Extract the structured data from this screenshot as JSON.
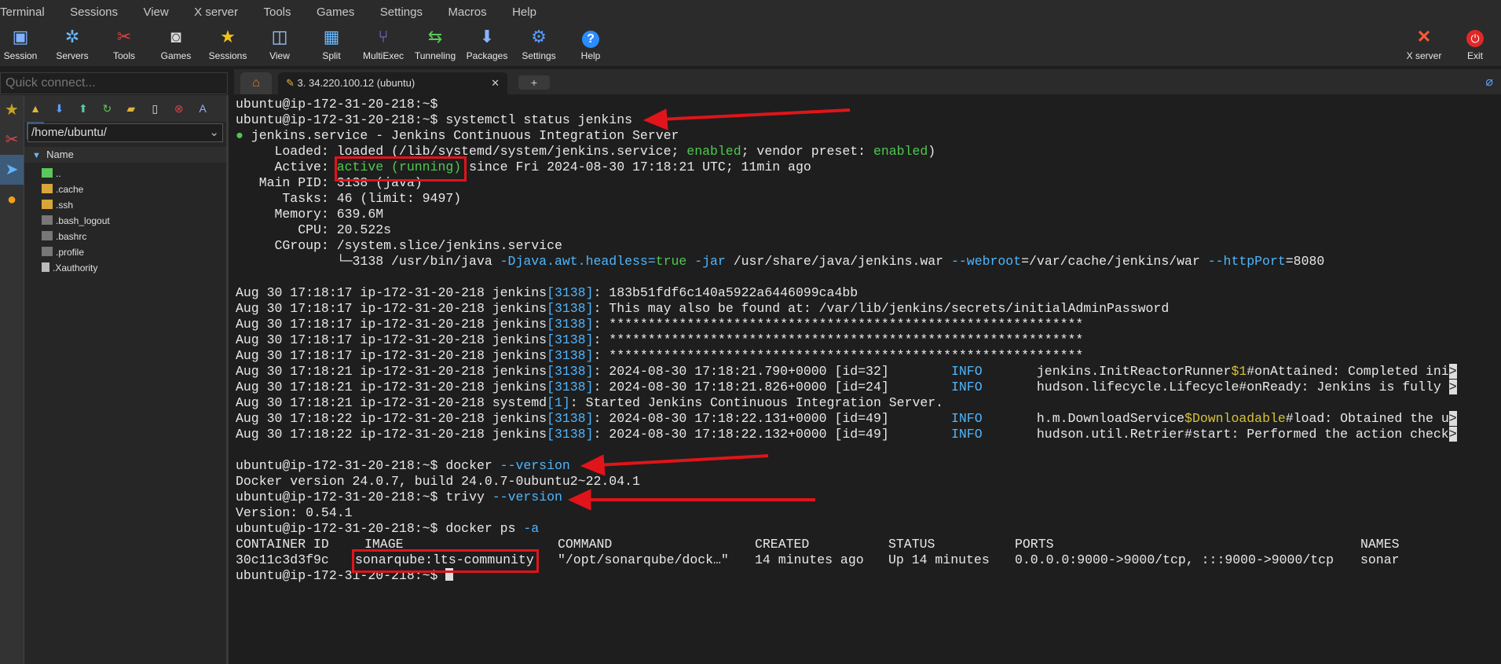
{
  "menu": [
    "Terminal",
    "Sessions",
    "View",
    "X server",
    "Tools",
    "Games",
    "Settings",
    "Macros",
    "Help"
  ],
  "toolbar": [
    {
      "label": "Session",
      "icon": "session-icon"
    },
    {
      "label": "Servers",
      "icon": "servers-icon"
    },
    {
      "label": "Tools",
      "icon": "tools-icon"
    },
    {
      "label": "Games",
      "icon": "games-icon"
    },
    {
      "label": "Sessions",
      "icon": "sessions-star-icon"
    },
    {
      "label": "View",
      "icon": "view-icon"
    },
    {
      "label": "Split",
      "icon": "split-icon"
    },
    {
      "label": "MultiExec",
      "icon": "multiexec-icon"
    },
    {
      "label": "Tunneling",
      "icon": "tunneling-icon"
    },
    {
      "label": "Packages",
      "icon": "packages-icon"
    },
    {
      "label": "Settings",
      "icon": "settings-icon"
    },
    {
      "label": "Help",
      "icon": "help-icon"
    }
  ],
  "toolbar_right": [
    {
      "label": "X server",
      "icon": "xserver-icon"
    },
    {
      "label": "Exit",
      "icon": "exit-icon"
    }
  ],
  "quick_connect": {
    "placeholder": "Quick connect..."
  },
  "file_panel": {
    "path": "/home/ubuntu/",
    "column": "Name",
    "files": [
      "..",
      ".cache",
      ".ssh",
      ".bash_logout",
      ".bashrc",
      ".profile",
      ".Xauthority"
    ]
  },
  "tabs": {
    "active": "3. 34.220.100.12 (ubuntu)"
  },
  "terminal": {
    "prompt": "ubuntu@ip-172-31-20-218:~$",
    "cmd_status": "systemctl status jenkins",
    "service_line": "jenkins.service - Jenkins Continuous Integration Server",
    "loaded_pre": "     Loaded: loaded (/lib/systemd/system/jenkins.service; ",
    "enabled": "enabled",
    "loaded_mid": "; vendor preset: ",
    "loaded_end": ")",
    "active_pre": "     Active: ",
    "active_state": "active (running)",
    "active_post": " since Fri 2024-08-30 17:18:21 UTC; 11min ago",
    "main_pid": "   Main PID: 3138 (java)",
    "tasks": "      Tasks: 46 (limit: 9497)",
    "memory": "     Memory: 639.6M",
    "cpu": "        CPU: 20.522s",
    "cgroup": "     CGroup: /system.slice/jenkins.service",
    "cgroup_proc": {
      "a": "             └─3138 /usr/bin/java ",
      "b": "-Djava.awt.headless=",
      "c": "true",
      "d": " ",
      "e": "-jar",
      "f": " /usr/share/java/jenkins.war ",
      "g": "--webroot",
      "h": "=/var/cache/jenkins/war ",
      "i": "--httpPort",
      "j": "=8080"
    },
    "logs": [
      {
        "pre": "Aug 30 17:18:17 ip-172-31-20-218 jenkins",
        "pid": "[3138]",
        "msg": ": 183b51fdf6c140a5922a6446099ca4bb"
      },
      {
        "pre": "Aug 30 17:18:17 ip-172-31-20-218 jenkins",
        "pid": "[3138]",
        "msg": ": This may also be found at: /var/lib/jenkins/secrets/initialAdminPassword"
      },
      {
        "pre": "Aug 30 17:18:17 ip-172-31-20-218 jenkins",
        "pid": "[3138]",
        "msg": ": *************************************************************"
      },
      {
        "pre": "Aug 30 17:18:17 ip-172-31-20-218 jenkins",
        "pid": "[3138]",
        "msg": ": *************************************************************"
      },
      {
        "pre": "Aug 30 17:18:17 ip-172-31-20-218 jenkins",
        "pid": "[3138]",
        "msg": ": *************************************************************"
      },
      {
        "pre": "Aug 30 17:18:21 ip-172-31-20-218 jenkins",
        "pid": "[3138]",
        "msg": ": 2024-08-30 17:18:21.790+0000 [id=32]",
        "lvl": "INFO",
        "src": "jenkins.InitReactorRunner",
        "hl": "$1",
        "rest": "#onAttained: Completed ini"
      },
      {
        "pre": "Aug 30 17:18:21 ip-172-31-20-218 jenkins",
        "pid": "[3138]",
        "msg": ": 2024-08-30 17:18:21.826+0000 [id=24]",
        "lvl": "INFO",
        "src": "hudson.lifecycle.Lifecycle#onReady: Jenkins is fully ",
        "hl": "",
        "rest": ""
      },
      {
        "pre": "Aug 30 17:18:21 ip-172-31-20-218 systemd",
        "pid": "[1]",
        "msg": ": Started Jenkins Continuous Integration Server."
      },
      {
        "pre": "Aug 30 17:18:22 ip-172-31-20-218 jenkins",
        "pid": "[3138]",
        "msg": ": 2024-08-30 17:18:22.131+0000 [id=49]",
        "lvl": "INFO",
        "src": "h.m.DownloadService",
        "hl": "$Downloadable",
        "rest": "#load: Obtained the u"
      },
      {
        "pre": "Aug 30 17:18:22 ip-172-31-20-218 jenkins",
        "pid": "[3138]",
        "msg": ": 2024-08-30 17:18:22.132+0000 [id=49]",
        "lvl": "INFO",
        "src": "hudson.util.Retrier#start: Performed the action check",
        "hl": "",
        "rest": ""
      }
    ],
    "cmd_docker": "docker ",
    "flag_version": "--version",
    "docker_out": "Docker version 24.0.7, build 24.0.7-0ubuntu2~22.04.1",
    "cmd_trivy": "trivy ",
    "trivy_out": "Version: 0.54.1",
    "cmd_ps": "docker ps ",
    "flag_a": "-a",
    "ps_header": {
      "id": "CONTAINER ID",
      "image": "IMAGE",
      "command": "COMMAND",
      "created": "CREATED",
      "status": "STATUS",
      "ports": "PORTS",
      "names": "NAMES"
    },
    "ps_row": {
      "id": "30c11c3d3f9c",
      "image": "sonarqube:lts-community",
      "command": "\"/opt/sonarqube/dock…\"",
      "created": "14 minutes ago",
      "status": "Up 14 minutes",
      "ports": "0.0.0.0:9000->9000/tcp, :::9000->9000/tcp",
      "names": "sonar"
    },
    "trunc": ">"
  },
  "colors": {
    "accent_red": "#e0141a",
    "green": "#4ec94e",
    "blue": "#4fb6ff",
    "yellow": "#d6c23a"
  }
}
